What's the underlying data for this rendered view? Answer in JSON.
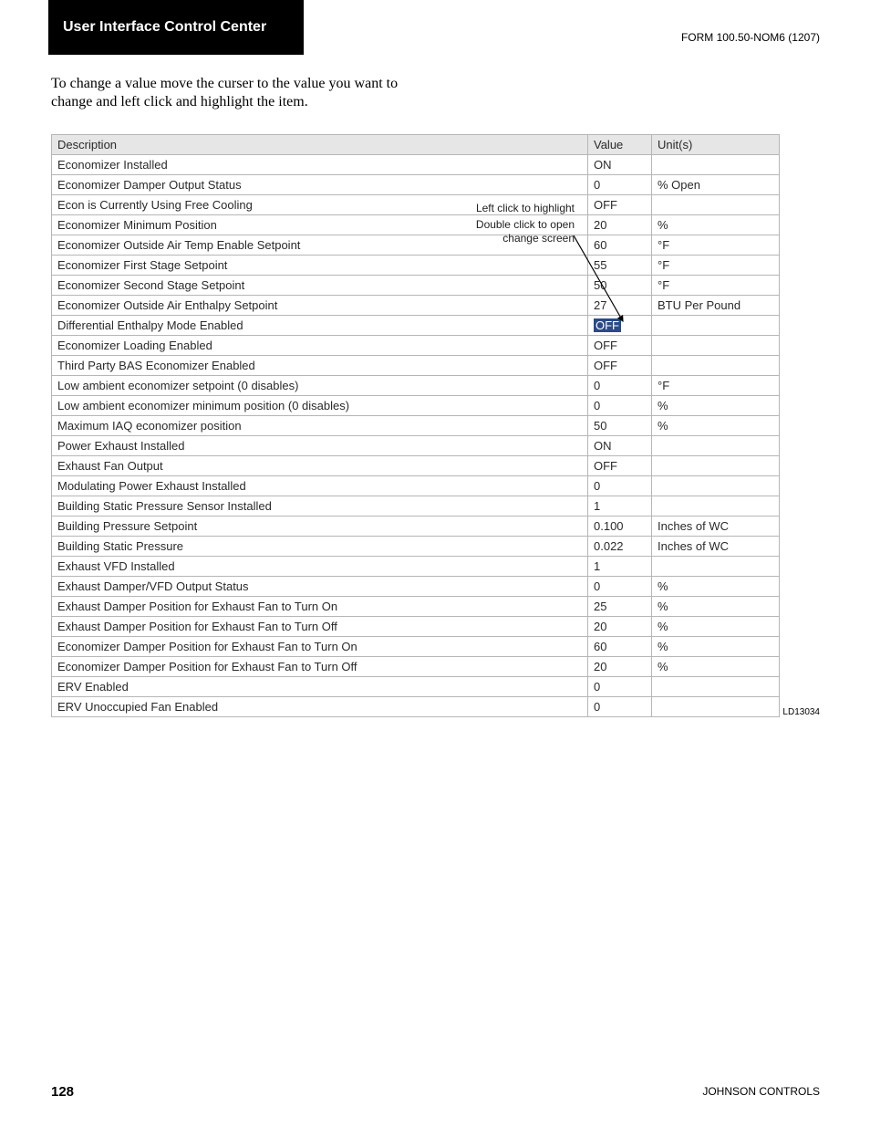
{
  "header": {
    "title": "User Interface Control Center",
    "form_id": "FORM 100.50-NOM6 (1207)"
  },
  "instructions": "To change a value move the curser to the value you want to change and left click and highlight the item.",
  "annotation": {
    "line1": "Left click to highlight",
    "line2": "Double click to open",
    "line3": "change screen"
  },
  "table": {
    "headers": {
      "description": "Description",
      "value": "Value",
      "units": "Unit(s)"
    },
    "rows": [
      {
        "indent": 0,
        "desc": "Economizer Installed",
        "value": "ON",
        "units": "",
        "highlighted": false
      },
      {
        "indent": 1,
        "desc": "Economizer Damper Output Status",
        "value": "0",
        "units": "% Open",
        "highlighted": false
      },
      {
        "indent": 1,
        "desc": "Econ is Currently Using Free Cooling",
        "value": "OFF",
        "units": "",
        "highlighted": false
      },
      {
        "indent": 1,
        "desc": "Economizer Minimum Position",
        "value": "20",
        "units": "%",
        "highlighted": false
      },
      {
        "indent": 1,
        "desc": "Economizer Outside Air Temp Enable Setpoint",
        "value": "60",
        "units": "°F",
        "highlighted": false
      },
      {
        "indent": 1,
        "desc": "Economizer First Stage Setpoint",
        "value": "55",
        "units": "°F",
        "highlighted": false
      },
      {
        "indent": 1,
        "desc": "Economizer Second Stage Setpoint",
        "value": "50",
        "units": "°F",
        "highlighted": false
      },
      {
        "indent": 1,
        "desc": "Economizer Outside Air Enthalpy Setpoint",
        "value": "27",
        "units": "BTU Per Pound",
        "highlighted": false
      },
      {
        "indent": 1,
        "desc": "Differential Enthalpy Mode Enabled",
        "value": "OFF",
        "units": "",
        "highlighted": true
      },
      {
        "indent": 1,
        "desc": "Economizer Loading Enabled",
        "value": "OFF",
        "units": "",
        "highlighted": false
      },
      {
        "indent": 1,
        "desc": "Third Party BAS Economizer Enabled",
        "value": "OFF",
        "units": "",
        "highlighted": false
      },
      {
        "indent": 1,
        "desc": "Low ambient economizer setpoint (0 disables)",
        "value": "0",
        "units": "°F",
        "highlighted": false
      },
      {
        "indent": 1,
        "desc": "Low ambient economizer minimum position (0 disables)",
        "value": "0",
        "units": "%",
        "highlighted": false
      },
      {
        "indent": 1,
        "desc": "Maximum IAQ  economizer position",
        "value": "50",
        "units": "%",
        "highlighted": false
      },
      {
        "indent": 0,
        "desc": "Power Exhaust Installed",
        "value": "ON",
        "units": "",
        "highlighted": false
      },
      {
        "indent": 1,
        "desc": "Exhaust Fan Output",
        "value": "OFF",
        "units": "",
        "highlighted": false
      },
      {
        "indent": 1,
        "desc": "Modulating Power Exhaust Installed",
        "value": "0",
        "units": "",
        "highlighted": false
      },
      {
        "indent": 1,
        "desc": "Building Static Pressure Sensor Installed",
        "value": "1",
        "units": "",
        "highlighted": false
      },
      {
        "indent": 2,
        "desc": "Building Pressure Setpoint",
        "value": "0.100",
        "units": "Inches of WC",
        "highlighted": false
      },
      {
        "indent": 2,
        "desc": "Building Static Pressure",
        "value": "0.022",
        "units": "Inches of WC",
        "highlighted": false
      },
      {
        "indent": 1,
        "desc": "Exhaust VFD Installed",
        "value": "1",
        "units": "",
        "highlighted": false
      },
      {
        "indent": 1,
        "desc": "Exhaust Damper/VFD Output Status",
        "value": "0",
        "units": "%",
        "highlighted": false
      },
      {
        "indent": 1,
        "desc": "Exhaust Damper Position for Exhaust Fan to Turn On",
        "value": "25",
        "units": "%",
        "highlighted": false
      },
      {
        "indent": 1,
        "desc": "Exhaust Damper Position for Exhaust Fan to Turn Off",
        "value": "20",
        "units": "%",
        "highlighted": false
      },
      {
        "indent": 1,
        "desc": "Economizer Damper Position for Exhaust Fan to Turn On",
        "value": "60",
        "units": "%",
        "highlighted": false
      },
      {
        "indent": 1,
        "desc": "Economizer Damper Position for Exhaust Fan to Turn Off",
        "value": "20",
        "units": "%",
        "highlighted": false
      },
      {
        "indent": 0,
        "desc": "ERV Enabled",
        "value": "0",
        "units": "",
        "highlighted": false
      },
      {
        "indent": 0,
        "desc": "ERV Unoccupied Fan Enabled",
        "value": "0",
        "units": "",
        "highlighted": false
      }
    ]
  },
  "figure_label": "LD13034",
  "footer": {
    "page": "128",
    "company": "JOHNSON CONTROLS"
  }
}
